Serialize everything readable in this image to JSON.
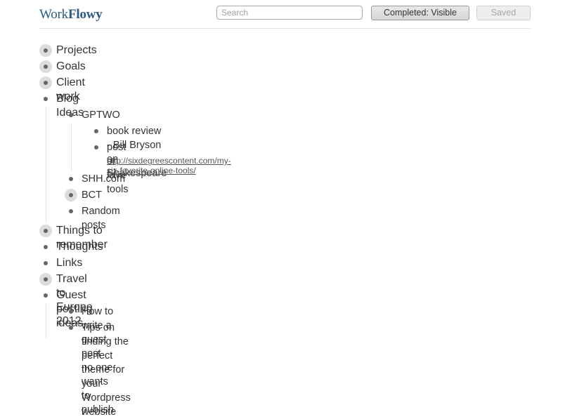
{
  "app": {
    "logo_light": "Work",
    "logo_bold": "Flowy"
  },
  "header": {
    "search_placeholder": "Search",
    "completed_button": "Completed: Visible",
    "saved_button": "Saved"
  },
  "outline": {
    "projects": "Projects",
    "goals": "Goals",
    "client_work": "Client work",
    "blog_ideas": {
      "label": "Blog Ideas",
      "children": {
        "gptwo": {
          "label": "GPTWO",
          "children": {
            "book_review": "book review - Bill Bryson on Shakespeare",
            "fave_tools": {
              "label": "post on fave tools",
              "note": "http://sixdegreescontent.com/my-six-favorite-online-tools/"
            }
          }
        },
        "shh": "SHH.com",
        "bct": "BCT",
        "random": "Random posts"
      }
    },
    "things_to_remember": "Things to remember",
    "thoughts": "Thoughts",
    "links": "Links",
    "travel": "Travel to Europe 2012",
    "guest_posting": {
      "label": "Guest posting ideas",
      "children": {
        "how_to": "How to write a guest post no one wants to publish",
        "tips": "Tips on finding the perfect theme for your Wordpress website"
      }
    }
  }
}
